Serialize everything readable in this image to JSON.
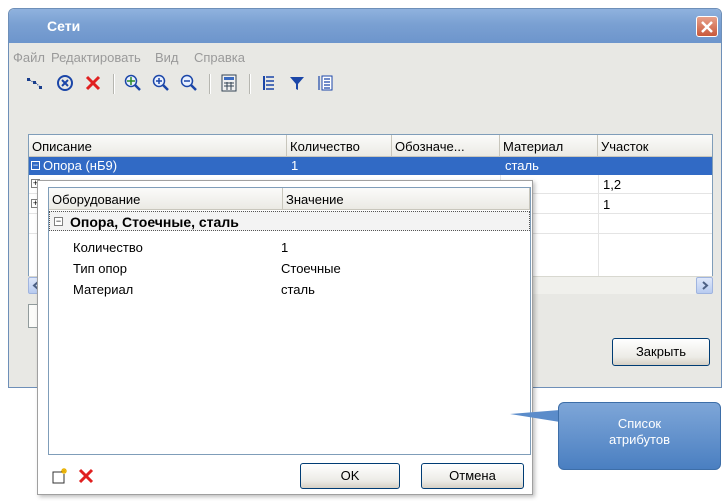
{
  "window": {
    "title": "Сети"
  },
  "menu": [
    "Файл",
    "Редактировать",
    "Вид",
    "Справка"
  ],
  "grid": {
    "columns": [
      "Описание",
      "Количество",
      "Обозначе...",
      "Материал",
      "Участок"
    ],
    "rows": [
      {
        "desc": "Опора (нБ9)",
        "qty": "1",
        "material": "сталь",
        "section": ""
      },
      {
        "material": "ль",
        "section": "1,2"
      },
      {
        "material": "ль",
        "section": "1"
      }
    ]
  },
  "buttons": {
    "close": "Закрыть",
    "ok": "OK",
    "cancel": "Отмена"
  },
  "popup": {
    "columns": [
      "Оборудование",
      "Значение"
    ],
    "group": "Опора, Стоечные, сталь",
    "attributes": [
      {
        "name": "Количество",
        "value": "1"
      },
      {
        "name": "Тип опор",
        "value": "Стоечные"
      },
      {
        "name": "Материал",
        "value": "сталь"
      }
    ]
  },
  "callout": {
    "line1": "Список",
    "line2": "атрибутов"
  },
  "colors": {
    "titlebar": "#7aa0d2",
    "selection": "#316ac5",
    "callout": "#5b8cca",
    "delete": "#e02020"
  }
}
